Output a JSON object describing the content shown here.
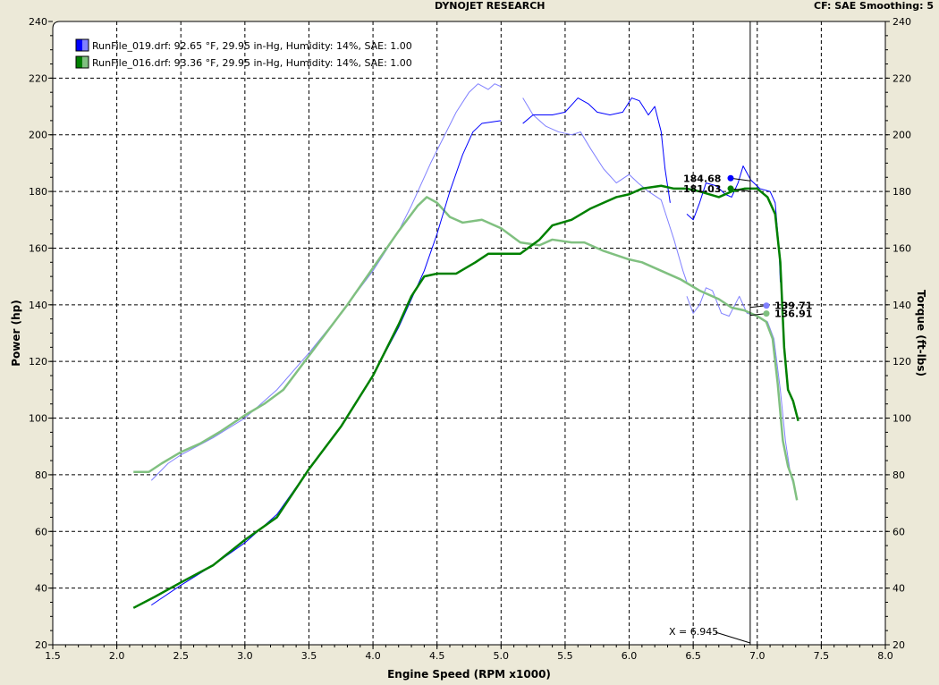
{
  "header": {
    "title": "DYNOJET RESEARCH",
    "settings": "CF: SAE  Smoothing: 5"
  },
  "colors": {
    "run019_power": "#0000ff",
    "run019_torque": "#8080ff",
    "run016_power": "#008000",
    "run016_torque": "#80c080"
  },
  "chart_data": {
    "type": "line",
    "title": "DYNOJET RESEARCH",
    "xlabel": "Engine Speed (RPM x1000)",
    "ylabel": "Power (hp)",
    "y2label": "Torque (ft-lbs)",
    "xlim": [
      1.5,
      8.0
    ],
    "ylim": [
      20,
      240
    ],
    "xticks": [
      "1.5",
      "2.0",
      "2.5",
      "3.0",
      "3.5",
      "4.0",
      "4.5",
      "5.0",
      "5.5",
      "6.0",
      "6.5",
      "7.0",
      "7.5",
      "8.0"
    ],
    "yticks": [
      "20",
      "40",
      "60",
      "80",
      "100",
      "120",
      "140",
      "160",
      "180",
      "200",
      "220",
      "240"
    ],
    "grid": true,
    "legend_placement": "top-left",
    "legend": [
      {
        "label": "RunFile_019.drf: 92.65 °F, 29.95 in-Hg, Humidity: 14%, SAE: 1.00",
        "color": "#0000ff",
        "color2": "#8080ff"
      },
      {
        "label": "RunFile_016.drf: 93.36 °F, 29.95 in-Hg, Humidity: 14%, SAE: 1.00",
        "color": "#008000",
        "color2": "#80c080"
      }
    ],
    "cursor": {
      "x": 6.945,
      "label": "X = 6.945"
    },
    "annotations": [
      {
        "text": "184.68",
        "series": "RunFile_019 Power",
        "value": 184.68
      },
      {
        "text": "181.03",
        "series": "RunFile_016 Power",
        "value": 181.03
      },
      {
        "text": "139.71",
        "series": "RunFile_019 Torque",
        "value": 139.71
      },
      {
        "text": "136.91",
        "series": "RunFile_016 Torque",
        "value": 136.91
      }
    ],
    "series": [
      {
        "name": "RunFile_019 Torque",
        "color": "#8080ff",
        "width": 1,
        "segments": [
          [
            [
              2.27,
              78
            ],
            [
              2.4,
              84
            ],
            [
              2.5,
              87
            ],
            [
              2.75,
              93
            ],
            [
              3.0,
              100
            ],
            [
              3.25,
              110
            ],
            [
              3.5,
              123
            ],
            [
              3.75,
              137
            ],
            [
              4.0,
              152
            ],
            [
              4.2,
              166
            ],
            [
              4.3,
              175
            ],
            [
              4.45,
              190
            ],
            [
              4.55,
              199
            ],
            [
              4.65,
              208
            ],
            [
              4.75,
              215
            ],
            [
              4.82,
              218
            ],
            [
              4.9,
              216
            ],
            [
              4.95,
              218
            ],
            [
              5.0,
              217
            ]
          ],
          [
            [
              5.17,
              213
            ],
            [
              5.25,
              207
            ],
            [
              5.35,
              203
            ],
            [
              5.45,
              201
            ],
            [
              5.55,
              200
            ],
            [
              5.62,
              201
            ],
            [
              5.7,
              195
            ],
            [
              5.8,
              188
            ],
            [
              5.9,
              183
            ],
            [
              6.0,
              186
            ],
            [
              6.07,
              183
            ],
            [
              6.15,
              180
            ],
            [
              6.25,
              177
            ],
            [
              6.3,
              170
            ],
            [
              6.35,
              163
            ],
            [
              6.42,
              152
            ],
            [
              6.45,
              148
            ]
          ],
          [
            [
              6.45,
              143
            ],
            [
              6.5,
              137
            ],
            [
              6.55,
              140
            ],
            [
              6.6,
              146
            ],
            [
              6.65,
              145
            ],
            [
              6.72,
              137
            ],
            [
              6.78,
              136
            ],
            [
              6.86,
              143
            ],
            [
              6.92,
              137
            ],
            [
              7.0,
              136
            ],
            [
              7.08,
              134
            ],
            [
              7.13,
              128
            ],
            [
              7.18,
              110
            ],
            [
              7.22,
              92
            ],
            [
              7.26,
              80
            ],
            [
              7.3,
              74
            ]
          ]
        ]
      },
      {
        "name": "RunFile_016 Torque",
        "color": "#80c080",
        "width": 2.5,
        "segments": [
          [
            [
              2.13,
              81
            ],
            [
              2.25,
              81
            ],
            [
              2.35,
              84
            ],
            [
              2.5,
              88
            ],
            [
              2.65,
              91
            ],
            [
              2.8,
              95
            ],
            [
              3.0,
              101
            ],
            [
              3.15,
              105
            ],
            [
              3.3,
              110
            ],
            [
              3.45,
              119
            ],
            [
              3.6,
              128
            ],
            [
              3.8,
              140
            ],
            [
              4.0,
              153
            ],
            [
              4.2,
              166
            ],
            [
              4.35,
              175
            ],
            [
              4.42,
              178
            ],
            [
              4.5,
              176
            ],
            [
              4.6,
              171
            ],
            [
              4.7,
              169
            ],
            [
              4.85,
              170
            ],
            [
              5.0,
              167
            ],
            [
              5.15,
              162
            ],
            [
              5.3,
              161
            ],
            [
              5.4,
              163
            ],
            [
              5.55,
              162
            ],
            [
              5.65,
              162
            ],
            [
              5.8,
              159
            ],
            [
              6.0,
              156
            ],
            [
              6.1,
              155
            ],
            [
              6.25,
              152
            ],
            [
              6.4,
              149
            ],
            [
              6.55,
              145
            ],
            [
              6.7,
              142
            ],
            [
              6.8,
              139
            ],
            [
              6.9,
              138
            ],
            [
              7.0,
              136
            ],
            [
              7.07,
              134
            ],
            [
              7.12,
              128
            ],
            [
              7.16,
              112
            ],
            [
              7.2,
              92
            ],
            [
              7.24,
              83
            ],
            [
              7.28,
              78
            ],
            [
              7.31,
              71
            ]
          ]
        ]
      },
      {
        "name": "RunFile_019 Power",
        "color": "#0000ff",
        "width": 1,
        "segments": [
          [
            [
              2.27,
              34
            ],
            [
              2.5,
              41
            ],
            [
              2.75,
              48
            ],
            [
              3.0,
              56
            ],
            [
              3.25,
              66
            ],
            [
              3.5,
              82
            ],
            [
              3.75,
              97
            ],
            [
              4.0,
              115
            ],
            [
              4.2,
              132
            ],
            [
              4.3,
              142
            ],
            [
              4.4,
              152
            ],
            [
              4.5,
              165
            ],
            [
              4.6,
              180
            ],
            [
              4.7,
              193
            ],
            [
              4.78,
              201
            ],
            [
              4.85,
              204
            ],
            [
              5.0,
              205
            ]
          ],
          [
            [
              5.17,
              204
            ],
            [
              5.25,
              207
            ],
            [
              5.4,
              207
            ],
            [
              5.5,
              208
            ],
            [
              5.6,
              213
            ],
            [
              5.68,
              211
            ],
            [
              5.75,
              208
            ],
            [
              5.85,
              207
            ],
            [
              5.95,
              208
            ],
            [
              6.02,
              213
            ],
            [
              6.08,
              212
            ],
            [
              6.15,
              207
            ],
            [
              6.2,
              210
            ],
            [
              6.25,
              201
            ],
            [
              6.28,
              188
            ],
            [
              6.32,
              176
            ]
          ],
          [
            [
              6.45,
              172
            ],
            [
              6.5,
              170
            ],
            [
              6.55,
              176
            ],
            [
              6.6,
              183
            ],
            [
              6.68,
              182
            ],
            [
              6.75,
              179
            ],
            [
              6.8,
              178
            ],
            [
              6.85,
              183
            ],
            [
              6.89,
              189
            ],
            [
              6.95,
              184
            ],
            [
              7.02,
              181
            ],
            [
              7.1,
              180
            ],
            [
              7.14,
              176
            ],
            [
              7.17,
              160
            ],
            [
              7.18,
              148
            ]
          ]
        ]
      },
      {
        "name": "RunFile_016 Power",
        "color": "#008000",
        "width": 2.5,
        "segments": [
          [
            [
              2.13,
              33
            ],
            [
              2.3,
              37
            ],
            [
              2.5,
              42
            ],
            [
              2.75,
              48
            ],
            [
              3.0,
              57
            ],
            [
              3.25,
              65
            ],
            [
              3.5,
              82
            ],
            [
              3.75,
              97
            ],
            [
              4.0,
              115
            ],
            [
              4.2,
              133
            ],
            [
              4.3,
              143
            ],
            [
              4.4,
              150
            ],
            [
              4.5,
              151
            ],
            [
              4.65,
              151
            ],
            [
              4.8,
              155
            ],
            [
              4.9,
              158
            ],
            [
              5.0,
              158
            ],
            [
              5.15,
              158
            ],
            [
              5.3,
              163
            ],
            [
              5.4,
              168
            ],
            [
              5.55,
              170
            ],
            [
              5.7,
              174
            ],
            [
              5.8,
              176
            ],
            [
              5.9,
              178
            ],
            [
              6.0,
              179
            ],
            [
              6.1,
              181
            ],
            [
              6.25,
              182
            ],
            [
              6.35,
              181
            ],
            [
              6.45,
              181
            ],
            [
              6.55,
              180
            ],
            [
              6.7,
              178
            ],
            [
              6.8,
              180
            ],
            [
              6.9,
              181
            ],
            [
              7.0,
              181
            ],
            [
              7.08,
              178
            ],
            [
              7.14,
              172
            ],
            [
              7.18,
              155
            ],
            [
              7.21,
              125
            ],
            [
              7.24,
              110
            ],
            [
              7.28,
              106
            ],
            [
              7.32,
              99
            ]
          ]
        ]
      }
    ]
  }
}
